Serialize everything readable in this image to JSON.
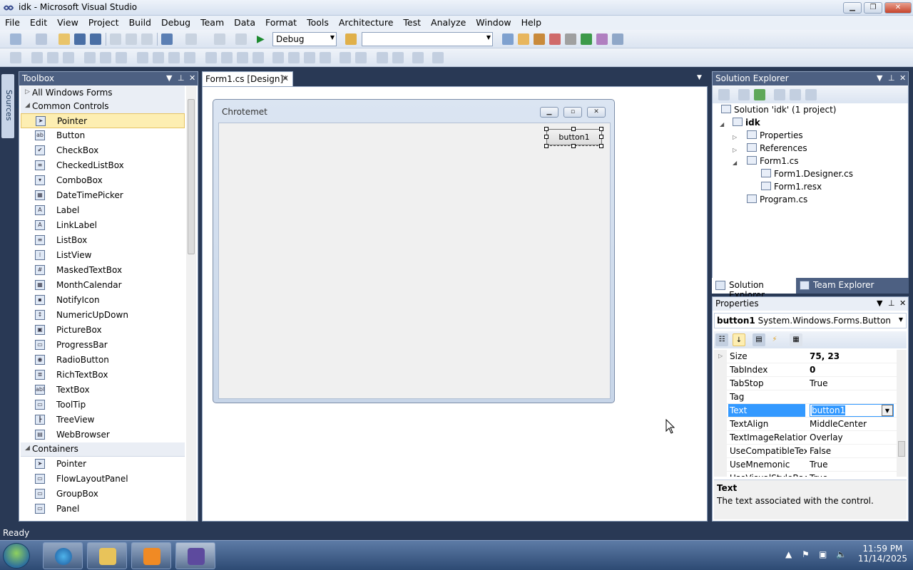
{
  "window": {
    "title": "idk - Microsoft Visual Studio",
    "controls": [
      "▁",
      "❐",
      "✕"
    ]
  },
  "menu": [
    "File",
    "Edit",
    "View",
    "Project",
    "Build",
    "Debug",
    "Team",
    "Data",
    "Format",
    "Tools",
    "Architecture",
    "Test",
    "Analyze",
    "Window",
    "Help"
  ],
  "toolbar": {
    "config": "Debug",
    "platform": ""
  },
  "rail": {
    "data_sources": "Data Sources"
  },
  "toolbox": {
    "title": "Toolbox",
    "groups": [
      {
        "label": "All Windows Forms",
        "expanded": false
      },
      {
        "label": "Common Controls",
        "expanded": true
      },
      {
        "label": "Containers",
        "expanded": true
      }
    ],
    "common_items": [
      {
        "label": "Pointer",
        "icon": "pointer-icon",
        "glyph": "➤",
        "selected": true
      },
      {
        "label": "Button",
        "icon": "button-icon",
        "glyph": "ab"
      },
      {
        "label": "CheckBox",
        "icon": "checkbox-icon",
        "glyph": "✔"
      },
      {
        "label": "CheckedListBox",
        "icon": "checkedlistbox-icon",
        "glyph": "≡"
      },
      {
        "label": "ComboBox",
        "icon": "combobox-icon",
        "glyph": "▾"
      },
      {
        "label": "DateTimePicker",
        "icon": "datetimepicker-icon",
        "glyph": "▦"
      },
      {
        "label": "Label",
        "icon": "label-icon",
        "glyph": "A"
      },
      {
        "label": "LinkLabel",
        "icon": "linklabel-icon",
        "glyph": "A"
      },
      {
        "label": "ListBox",
        "icon": "listbox-icon",
        "glyph": "≡"
      },
      {
        "label": "ListView",
        "icon": "listview-icon",
        "glyph": "⁞"
      },
      {
        "label": "MaskedTextBox",
        "icon": "maskedtextbox-icon",
        "glyph": "#"
      },
      {
        "label": "MonthCalendar",
        "icon": "monthcalendar-icon",
        "glyph": "▦"
      },
      {
        "label": "NotifyIcon",
        "icon": "notifyicon-icon",
        "glyph": "▪"
      },
      {
        "label": "NumericUpDown",
        "icon": "numericupdown-icon",
        "glyph": "↕"
      },
      {
        "label": "PictureBox",
        "icon": "picturebox-icon",
        "glyph": "▣"
      },
      {
        "label": "ProgressBar",
        "icon": "progressbar-icon",
        "glyph": "▭"
      },
      {
        "label": "RadioButton",
        "icon": "radiobutton-icon",
        "glyph": "◉"
      },
      {
        "label": "RichTextBox",
        "icon": "richtextbox-icon",
        "glyph": "≣"
      },
      {
        "label": "TextBox",
        "icon": "textbox-icon",
        "glyph": "abl"
      },
      {
        "label": "ToolTip",
        "icon": "tooltip-icon",
        "glyph": "▭"
      },
      {
        "label": "TreeView",
        "icon": "treeview-icon",
        "glyph": "┣"
      },
      {
        "label": "WebBrowser",
        "icon": "webbrowser-icon",
        "glyph": "▤"
      }
    ],
    "container_items": [
      {
        "label": "Pointer",
        "icon": "pointer-icon",
        "glyph": "➤"
      },
      {
        "label": "FlowLayoutPanel",
        "icon": "flowlayoutpanel-icon",
        "glyph": "▭"
      },
      {
        "label": "GroupBox",
        "icon": "groupbox-icon",
        "glyph": "▭"
      },
      {
        "label": "Panel",
        "icon": "panel-icon",
        "glyph": "▭"
      }
    ]
  },
  "document": {
    "tab": "Form1.cs [Design]*",
    "form_title": "Chrotemet",
    "button_text": "button1"
  },
  "solution_explorer": {
    "title": "Solution Explorer",
    "items": [
      {
        "label": "Solution 'idk' (1 project)"
      },
      {
        "label": "idk",
        "bold": true
      },
      {
        "label": "Properties"
      },
      {
        "label": "References"
      },
      {
        "label": "Form1.cs"
      },
      {
        "label": "Form1.Designer.cs"
      },
      {
        "label": "Form1.resx"
      },
      {
        "label": "Program.cs"
      }
    ],
    "tabs": [
      "Solution Explorer",
      "Team Explorer"
    ]
  },
  "properties": {
    "title": "Properties",
    "object_name": "button1",
    "object_type": "System.Windows.Forms.Button",
    "rows": [
      {
        "name": "Size",
        "value": "75, 23",
        "bold": true,
        "expandable": true
      },
      {
        "name": "TabIndex",
        "value": "0",
        "bold": true
      },
      {
        "name": "TabStop",
        "value": "True"
      },
      {
        "name": "Tag",
        "value": ""
      },
      {
        "name": "Text",
        "value": "button1",
        "selected": true
      },
      {
        "name": "TextAlign",
        "value": "MiddleCenter"
      },
      {
        "name": "TextImageRelation",
        "value": "Overlay"
      },
      {
        "name": "UseCompatibleTextRendering",
        "value": "False"
      },
      {
        "name": "UseMnemonic",
        "value": "True"
      },
      {
        "name": "UseVisualStyleBackColor",
        "value": "True"
      }
    ],
    "desc_title": "Text",
    "desc_text": "The text associated with the control."
  },
  "status": {
    "text": "Ready"
  },
  "taskbar": {
    "time": "11:59 PM",
    "date": "11/14/2025",
    "apps": [
      "browser",
      "explorer",
      "media-player",
      "visual-studio"
    ]
  }
}
